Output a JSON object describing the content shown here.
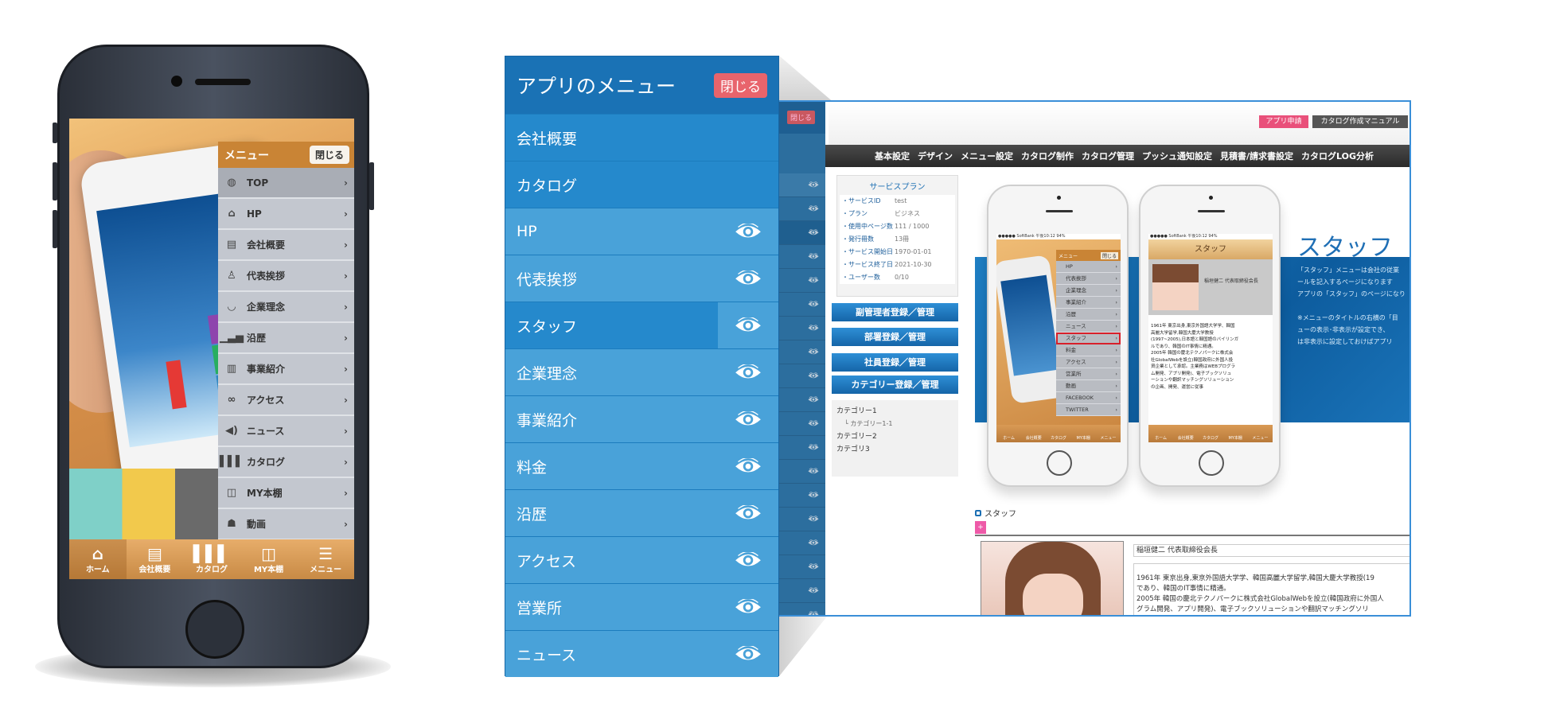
{
  "phone": {
    "menu_title": "メニュー",
    "close_label": "閉じる",
    "menu_items": [
      {
        "label": "TOP",
        "icon": "globe-icon",
        "glyph": "◍"
      },
      {
        "label": "HP",
        "icon": "house-icon",
        "glyph": "⌂"
      },
      {
        "label": "会社概要",
        "icon": "document-icon",
        "glyph": "▤"
      },
      {
        "label": "代表挨拶",
        "icon": "person-icon",
        "glyph": "♙"
      },
      {
        "label": "企業理念",
        "icon": "laurel-icon",
        "glyph": "◡"
      },
      {
        "label": "沿歴",
        "icon": "signal-bars-icon",
        "glyph": "▁▃▅"
      },
      {
        "label": "事業紹介",
        "icon": "notebook-icon",
        "glyph": "▥"
      },
      {
        "label": "アクセス",
        "icon": "link-icon",
        "glyph": "∞"
      },
      {
        "label": "ニュース",
        "icon": "megaphone-icon",
        "glyph": "◀)"
      },
      {
        "label": "カタログ",
        "icon": "chart-bars-icon",
        "glyph": "▌▌▌"
      },
      {
        "label": "MY本棚",
        "icon": "open-book-icon",
        "glyph": "◫"
      },
      {
        "label": "動画",
        "icon": "people-icon",
        "glyph": "☗"
      }
    ],
    "tabs": [
      {
        "label": "ホーム",
        "glyph": "⌂",
        "icon": "home-icon"
      },
      {
        "label": "会社概要",
        "glyph": "▤",
        "icon": "document-icon"
      },
      {
        "label": "カタログ",
        "glyph": "▌▌▌",
        "icon": "chart-bars-icon"
      },
      {
        "label": "MY本棚",
        "glyph": "◫",
        "icon": "open-book-icon"
      },
      {
        "label": "メニュー",
        "glyph": "☰",
        "icon": "menu-icon"
      }
    ]
  },
  "panel": {
    "title": "アプリのメニュー",
    "close_label": "閉じる",
    "items": [
      {
        "label": "会社概要",
        "visible_toggle": false
      },
      {
        "label": "カタログ",
        "visible_toggle": false
      },
      {
        "label": "HP",
        "visible_toggle": true
      },
      {
        "label": "代表挨拶",
        "visible_toggle": true
      },
      {
        "label": "スタッフ",
        "visible_toggle": true,
        "selected": true
      },
      {
        "label": "企業理念",
        "visible_toggle": true
      },
      {
        "label": "事業紹介",
        "visible_toggle": true
      },
      {
        "label": "料金",
        "visible_toggle": true
      },
      {
        "label": "沿歴",
        "visible_toggle": true
      },
      {
        "label": "アクセス",
        "visible_toggle": true
      },
      {
        "label": "営業所",
        "visible_toggle": true
      },
      {
        "label": "ニュース",
        "visible_toggle": true
      }
    ],
    "colors": {
      "header": "#1a72b5",
      "row": "#2589cc",
      "row_visible": "#49a2d9",
      "close": "#e8646c"
    }
  },
  "admin": {
    "strip_close": "閉じる",
    "apply_button": "アプリ申請",
    "manual_button": "カタログ作成マニュアル",
    "nav": [
      "基本設定",
      "デザイン",
      "メニュー設定",
      "カタログ制作",
      "カタログ管理",
      "プッシュ通知設定",
      "見積書/請求書設定",
      "カタログLOG分析"
    ],
    "plan": {
      "title": "サービスプラン",
      "rows": [
        {
          "k": "・サービスID",
          "v": "test"
        },
        {
          "k": "・プラン",
          "v": "ビジネス"
        },
        {
          "k": "・使用中ページ数",
          "v": "111 / 1000"
        },
        {
          "k": "・発行冊数",
          "v": "13冊"
        },
        {
          "k": "・サービス開始日",
          "v": "1970-01-01"
        },
        {
          "k": "・サービス終了日",
          "v": "2021-10-30"
        },
        {
          "k": "・ユーザー数",
          "v": "0/10"
        }
      ]
    },
    "side_buttons": [
      "副管理者登録／管理",
      "部署登録／管理",
      "社員登録／管理",
      "カテゴリー登録／管理"
    ],
    "categories": [
      {
        "label": "カテゴリー1",
        "sub": false
      },
      {
        "label": "└ カテゴリー1-1",
        "sub": true
      },
      {
        "label": "カテゴリー2",
        "sub": false
      },
      {
        "label": "カテゴリ3",
        "sub": false
      }
    ],
    "mock1": {
      "status": "●●●●● SoftBank  午後10:12  94%",
      "menu_title": "メニュー",
      "close": "閉じる",
      "items": [
        "HP",
        "代表挨拶",
        "企業理念",
        "事業紹介",
        "沿歴",
        "ニュース",
        "スタッフ",
        "料金",
        "アクセス",
        "営業所",
        "動画",
        "FACEBOOK",
        "TWITTER"
      ],
      "highlighted": "スタッフ",
      "tabs": [
        "ホーム",
        "会社概要",
        "カタログ",
        "MY本棚",
        "メニュー"
      ]
    },
    "mock2": {
      "status": "●●●●● SoftBank  午後10:12  94%",
      "title": "スタッフ",
      "name": "稲垣健二 代表取締役会長",
      "bio": [
        "1961年 東京出身,東京外国語大学学、韓国",
        "高麗大学留学,韓国大慶大学教授",
        "(1997~2005),日本語と韓国語のバイリンガ",
        "ルであり、韓国のIT事情に精通。",
        "2005年 韓国の慶北テクノパークに株式会",
        "社GlobalWebを設立(韓国政府に外国人投",
        "資企業として承認。主業務はWEBプログラ",
        "ム開発、アプリ開発)、電子ブックソリュ",
        "ーションや翻訳マッチングソリューション",
        "の企画、開発、運営に従事"
      ],
      "tabs": [
        "ホーム",
        "会社概要",
        "カタログ",
        "MY本棚",
        "メニュー"
      ]
    },
    "feature_title": "スタッフ",
    "feature_desc": [
      "「スタッフ」メニューは会社の従業",
      "ールを記入するページになります",
      "アプリの「スタッフ」のページになり",
      "",
      "※メニューのタイトルの右横の「目",
      "ューの表示･非表示が設定でき、",
      "は非表示に設定しておけばアプリ"
    ],
    "section_label": "スタッフ",
    "add_label": "+",
    "staff_name": "稲垣健二 代表取締役会長",
    "staff_bio": [
      "1961年 東京出身,東京外国語大学学、韓国高麗大学留学,韓国大慶大学教授(19",
      "であり、韓国のIT事情に精通。",
      "2005年 韓国の慶北テクノパークに株式会社GlobalWebを設立(韓国政府に外国人",
      "グラム開発、アプリ開発)、電子ブックソリューションや翻訳マッチングソリ"
    ]
  }
}
